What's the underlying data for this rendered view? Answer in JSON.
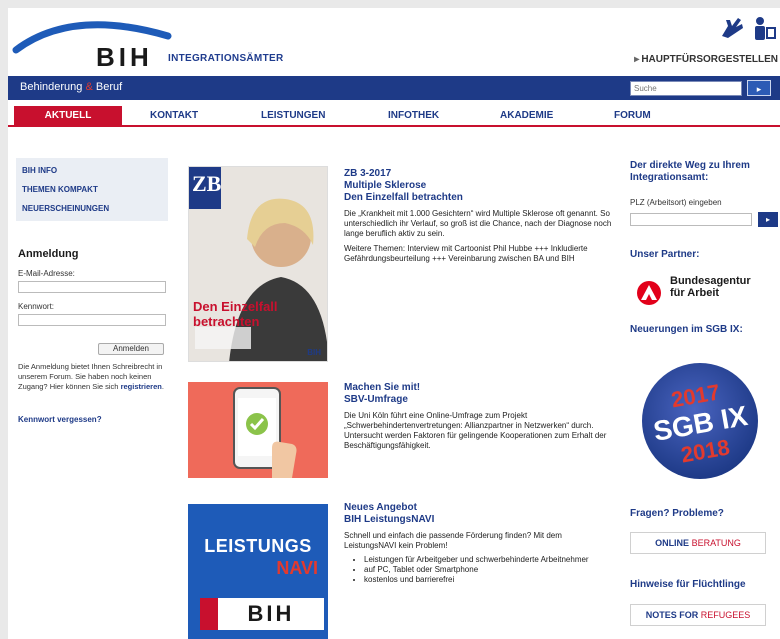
{
  "header": {
    "logo": "BIH",
    "subtitle": "INTEGRATIONSÄMTER",
    "hf_link": "HAUPTFÜRSORGESTELLEN"
  },
  "bluebar": {
    "title_a": "Behinderung",
    "title_amp": "&",
    "title_b": "Beruf",
    "search_placeholder": "Suche",
    "search_button": "▸"
  },
  "nav": {
    "items": [
      "AKTUELL",
      "KONTAKT",
      "LEISTUNGEN",
      "INFOTHEK",
      "AKADEMIE",
      "FORUM"
    ]
  },
  "left": {
    "menu": [
      "BIH INFO",
      "THEMEN KOMPAKT",
      "NEUERSCHEINUNGEN"
    ],
    "login_title": "Anmeldung",
    "email_label": "E-Mail-Adresse:",
    "password_label": "Kennwort:",
    "login_button": "Anmelden",
    "note_part1": "Die Anmeldung bietet Ihnen Schreibrecht in unserem Forum. Sie haben noch keinen Zugang? Hier können Sie sich",
    "note_link": "registrieren",
    "note_end": ".",
    "forgot": "Kennwort vergessen?"
  },
  "articles": [
    {
      "cat": "ZB 3-2017",
      "title1": "Multiple Sklerose",
      "title2": "Den Einzelfall betrachten",
      "body1": "Die „Krankheit mit 1.000 Gesichtern“ wird Multiple Sklerose oft genannt. So unterschiedlich ihr Verlauf, so groß ist die Chance, nach der Diagnose noch lange beruflich aktiv zu sein.",
      "body2": "Weitere Themen: Interview mit Cartoonist Phil Hubbe +++ Inkludierte Gefährdungsbeurteilung +++ Vereinbarung zwischen BA und BIH",
      "img_zb": "ZB",
      "img_headline1": "Den Einzelfall",
      "img_headline2": "betrachten",
      "img_bih": "BIH"
    },
    {
      "cat": "Machen Sie mit!",
      "title1": "SBV-Umfrage",
      "body1": "Die Uni Köln führt eine Online-Umfrage zum Projekt „Schwerbehindertenvertretungen: Allianzpartner in Netzwerken“ durch. Untersucht werden Faktoren für gelingende Kooperationen zum Erhalt der Beschäftigungsfähigkeit."
    },
    {
      "cat": "Neues Angebot",
      "title1": "BIH LeistungsNAVI",
      "body1": "Schnell und einfach die passende Förderung finden? Mit dem LeistungsNAVI kein Problem!",
      "list": [
        "Leistungen für Arbeitgeber und schwerbehinderte Arbeitnehmer",
        "auf PC, Tablet oder Smartphone",
        "kostenlos und barrierefrei"
      ],
      "img_l1": "LEISTUNGS",
      "img_l2": "NAVI",
      "img_bih": "BIH"
    }
  ],
  "right": {
    "direct_head": "Der direkte Weg zu Ihrem Integrationsamt:",
    "plz_label": "PLZ (Arbeitsort) eingeben",
    "plz_button": "▸",
    "partner_head": "Unser Partner:",
    "ba_line1": "Bundesagentur",
    "ba_line2": "für Arbeit",
    "sgb_head": "Neuerungen im SGB IX:",
    "sgb_year1": "2017",
    "sgb_text": "SGB IX",
    "sgb_year2": "2018",
    "questions_head": "Fragen? Probleme?",
    "online_a": "ONLINE",
    "online_b": "BERATUNG",
    "refugee_head": "Hinweise für Flüchtlinge",
    "notes_a": "NOTES FOR",
    "notes_b": "REFUGEES"
  },
  "colors": {
    "brand_blue": "#1e3a87",
    "brand_red": "#c8102e"
  }
}
